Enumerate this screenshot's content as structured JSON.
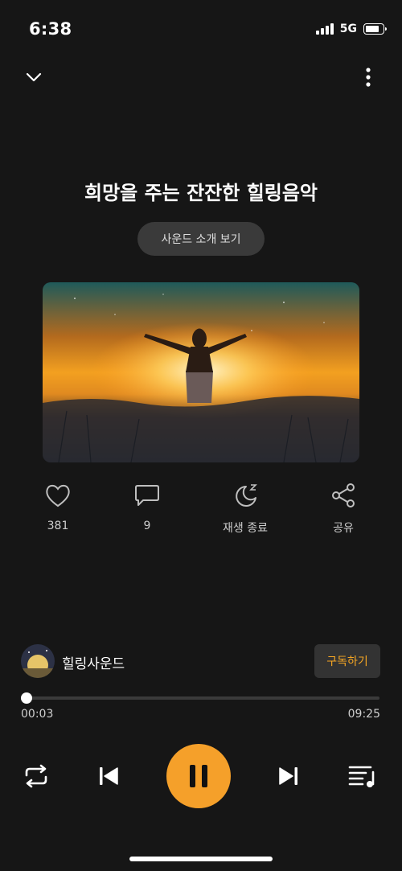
{
  "status_bar": {
    "time": "6:38",
    "network": "5G"
  },
  "header": {
    "title": "희망을 주는 잔잔한 힐링음악",
    "intro_button": "사운드 소개 보기"
  },
  "actions": [
    {
      "icon": "heart-icon",
      "label": "381"
    },
    {
      "icon": "comment-icon",
      "label": "9"
    },
    {
      "icon": "sleep-timer-icon",
      "label": "재생 종료"
    },
    {
      "icon": "share-icon",
      "label": "공유"
    }
  ],
  "channel": {
    "name": "힐링사운드",
    "subscribe_label": "구독하기"
  },
  "player": {
    "elapsed": "00:03",
    "duration": "09:25",
    "progress": 0.005
  },
  "colors": {
    "accent": "#f5a02a",
    "background": "#161616"
  }
}
